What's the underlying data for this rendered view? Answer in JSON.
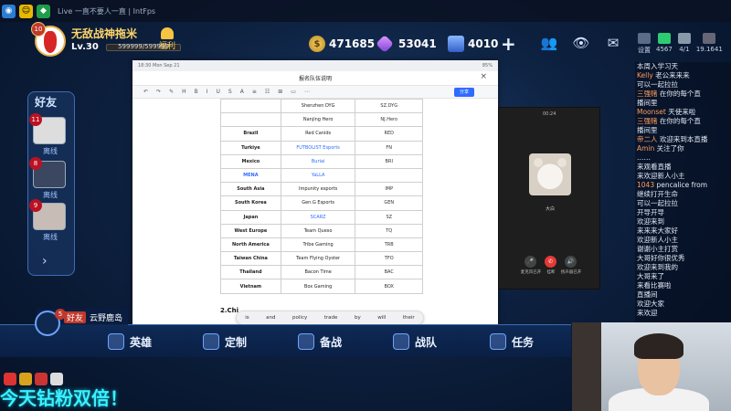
{
  "title_strip": {
    "window_title": "Live 一直不要人一直 | IntFps"
  },
  "player": {
    "name": "无敌战神拖米",
    "level": "Lv.30",
    "level_badge": "10",
    "exp_text": "599999/599999",
    "welfare_label": "福利"
  },
  "currency": {
    "gold": "471685",
    "gems": "53041",
    "tickets": "4010",
    "plus": "+"
  },
  "friends": {
    "title": "好友",
    "items": [
      {
        "badge": "11",
        "status": "离线"
      },
      {
        "badge": "8",
        "status": "离线"
      },
      {
        "badge": "9",
        "status": "离线"
      }
    ],
    "arrow": "›"
  },
  "friend_banner": {
    "badge": "5",
    "tag": "好友",
    "name": "云野鹿岛"
  },
  "bottom_nav": {
    "items": [
      {
        "label": "英雄"
      },
      {
        "label": "定制"
      },
      {
        "label": "备战"
      },
      {
        "label": "战队"
      },
      {
        "label": "任务"
      }
    ]
  },
  "promo": {
    "text": "今天钻粉双倍！"
  },
  "document": {
    "status_left": "18:30  Mon Sep 21",
    "status_right": "85%",
    "title": "报名队伍说明",
    "share_label": "分享",
    "close": "×",
    "toolbar": [
      "↶",
      "↷",
      "✎",
      "H",
      "B",
      "I",
      "U",
      "S",
      "A",
      "≡",
      "☷",
      "⊞",
      "▭",
      "⋯"
    ],
    "rows": [
      {
        "region": "",
        "team": "Shenzhen DYG",
        "abbr": "SZ.DYG",
        "team_link": false
      },
      {
        "region": "",
        "team": "Nanjing Hero",
        "abbr": "NJ.Hero",
        "team_link": false
      },
      {
        "region": "Brazil",
        "team": "Red Canids",
        "abbr": "RED",
        "team_link": false
      },
      {
        "region": "Turkiye",
        "team": "FUTBOLIST Esports",
        "abbr": "FN",
        "team_link": true
      },
      {
        "region": "Mexico",
        "team": "Buriai",
        "abbr": "BRI",
        "team_link": true
      },
      {
        "region": "MENA",
        "team": "YaLLA",
        "abbr": "",
        "team_link": true,
        "region_link": true
      },
      {
        "region": "South Asia",
        "team": "Impunity esports",
        "abbr": "IMP",
        "team_link": false
      },
      {
        "region": "South Korea",
        "team": "Gen.G Esports",
        "abbr": "GEN",
        "team_link": false
      },
      {
        "region": "Japan",
        "team": "SCARZ",
        "abbr": "SZ",
        "team_link": true
      },
      {
        "region": "West Europe",
        "team": "Team Queso",
        "abbr": "TQ",
        "team_link": false
      },
      {
        "region": "North America",
        "team": "Tribe Gaming",
        "abbr": "TRB",
        "team_link": false
      },
      {
        "region": "Taiwan China",
        "team": "Team Flying Oyster",
        "abbr": "TFO",
        "team_link": false
      },
      {
        "region": "Thailand",
        "team": "Bacon Time",
        "abbr": "BAC",
        "team_link": false
      },
      {
        "region": "Vietnam",
        "team": "Box Gaming",
        "abbr": "BOX",
        "team_link": false
      }
    ],
    "heading": "2.Chi",
    "suggestions": [
      "is",
      "and",
      "policy",
      "trade",
      "by",
      "will",
      "their"
    ]
  },
  "call": {
    "time": "00:24",
    "name": "大白",
    "buttons": [
      {
        "icon": "mic",
        "label": "麦克风已开"
      },
      {
        "icon": "hangup",
        "label": "挂断"
      },
      {
        "icon": "speaker",
        "label": "扬声器已开"
      }
    ]
  },
  "chat": {
    "lines": [
      {
        "user": "",
        "text": "本周入学习天"
      },
      {
        "user": "Kelly",
        "text": "老公来来来"
      },
      {
        "user": "",
        "text": "可以一起拉拉"
      },
      {
        "user": "三强赌",
        "text": "在你的每个直"
      },
      {
        "user": "",
        "text": "播间里"
      },
      {
        "user": "Moonset",
        "text": "天使来啦"
      },
      {
        "user": "三强赌",
        "text": "在你的每个直"
      },
      {
        "user": "",
        "text": "播间里"
      },
      {
        "user": "帝二人",
        "text": "欢迎来到本直播"
      },
      {
        "user": "Amin",
        "text": "关注了你"
      },
      {
        "user": "",
        "text": "……"
      },
      {
        "user": "",
        "text": "来观看直播"
      },
      {
        "user": "",
        "text": "来欢迎新人小主"
      },
      {
        "user": "1043",
        "text": "pencalice from"
      },
      {
        "user": "",
        "text": "继续打开生命"
      },
      {
        "user": "",
        "text": "可以一起拉拉"
      },
      {
        "user": "",
        "text": "开导开导"
      },
      {
        "user": "",
        "text": "欢迎来到"
      },
      {
        "user": "",
        "text": "来来来大家好"
      },
      {
        "user": "",
        "text": "欢迎新人小主"
      },
      {
        "user": "",
        "text": "谢谢小主打赏"
      },
      {
        "user": "",
        "text": "大哥好你很优秀"
      },
      {
        "user": "",
        "text": "欢迎来到我的"
      },
      {
        "user": "",
        "text": "大哥来了"
      },
      {
        "user": "",
        "text": "来看比赛啦"
      },
      {
        "user": "",
        "text": "直播间"
      },
      {
        "user": "",
        "text": "欢迎大家"
      },
      {
        "user": "",
        "text": "来欢迎"
      }
    ]
  },
  "tray": {
    "items": [
      "设置",
      "4567",
      "4/1",
      "19.1641"
    ]
  }
}
